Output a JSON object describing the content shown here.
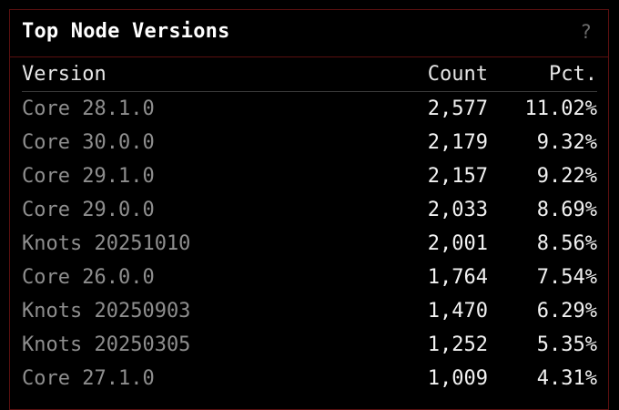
{
  "panel": {
    "title": "Top Node Versions",
    "help_label": "?"
  },
  "table": {
    "headers": {
      "version": "Version",
      "count": "Count",
      "pct": "Pct."
    },
    "rows": [
      {
        "version": "Core 28.1.0",
        "count": "2,577",
        "pct": "11.02%"
      },
      {
        "version": "Core 30.0.0",
        "count": "2,179",
        "pct": "9.32%"
      },
      {
        "version": "Core 29.1.0",
        "count": "2,157",
        "pct": "9.22%"
      },
      {
        "version": "Core 29.0.0",
        "count": "2,033",
        "pct": "8.69%"
      },
      {
        "version": "Knots 20251010",
        "count": "2,001",
        "pct": "8.56%"
      },
      {
        "version": "Core 26.0.0",
        "count": "1,764",
        "pct": "7.54%"
      },
      {
        "version": "Knots 20250903",
        "count": "1,470",
        "pct": "6.29%"
      },
      {
        "version": "Knots 20250305",
        "count": "1,252",
        "pct": "5.35%"
      },
      {
        "version": "Core 27.1.0",
        "count": "1,009",
        "pct": "4.31%"
      }
    ]
  },
  "colors": {
    "background": "#000000",
    "border": "#5a1010",
    "title": "#ffffff",
    "version_text": "#8e8e8e",
    "value_text": "#f2f2f2"
  },
  "icons": {
    "help": "question-mark-icon"
  }
}
